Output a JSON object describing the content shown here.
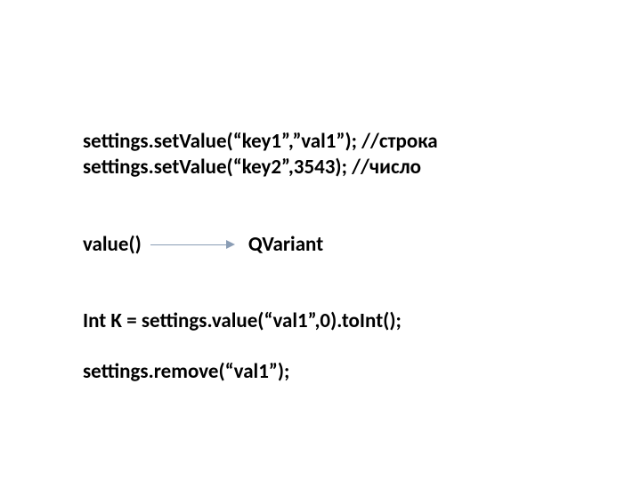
{
  "lines": {
    "line1": "settings.setValue(“key1”,”val1”); //строка",
    "line2": "settings.setValue(“key2”,3543); //число",
    "value_label": "value()",
    "qvariant_label": "QVariant",
    "line3": "Int K = settings.value(“val1”,0).toInt();",
    "line4": "settings.remove(“val1”);"
  }
}
